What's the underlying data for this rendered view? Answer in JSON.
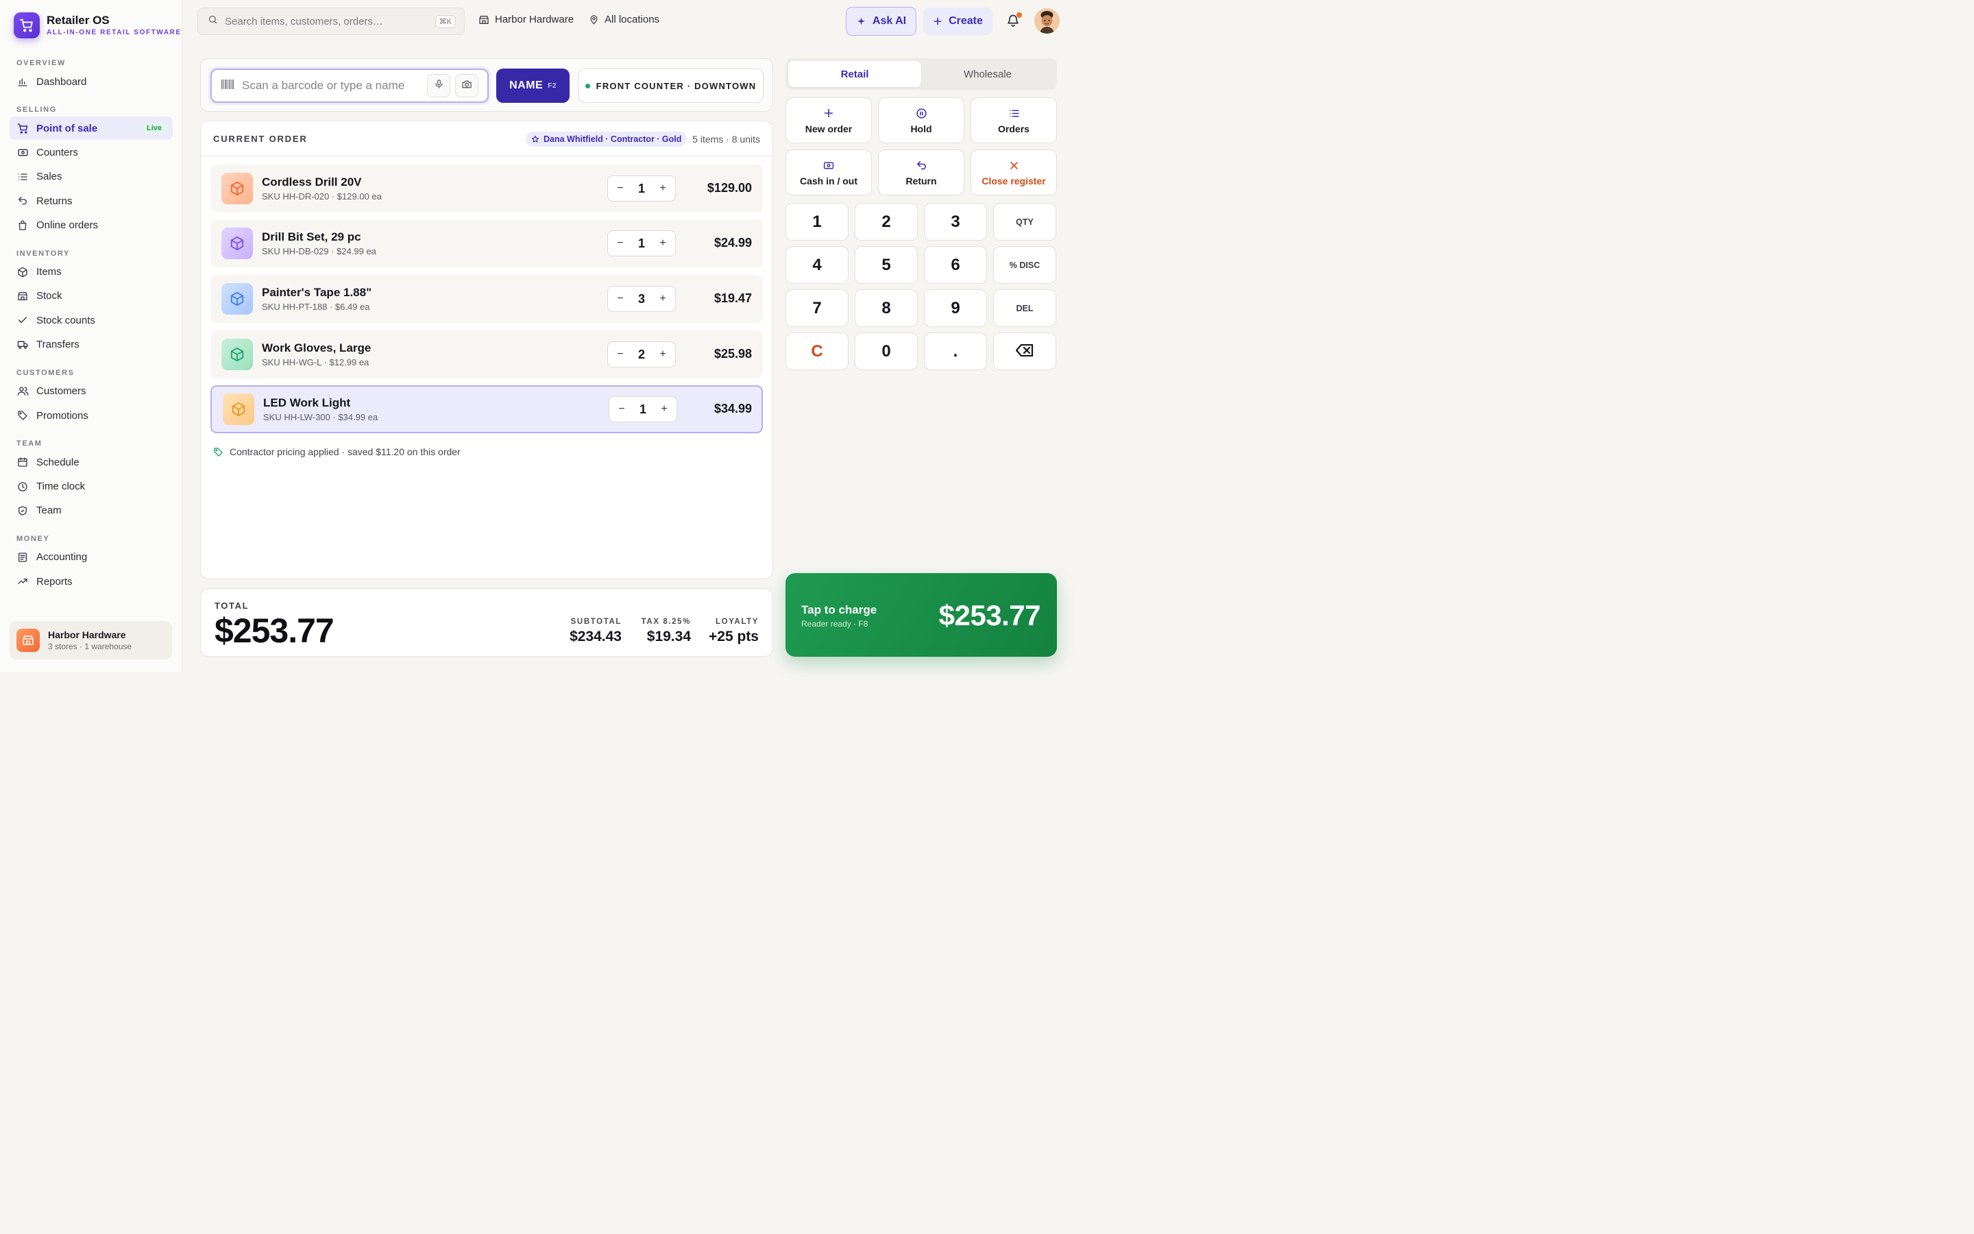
{
  "brand": {
    "name": "Retailer OS",
    "tagline": "ALL-IN-ONE RETAIL SOFTWARE"
  },
  "nav": {
    "sections": {
      "overview": "OVERVIEW",
      "selling": "SELLING",
      "inventory": "INVENTORY",
      "customers": "CUSTOMERS",
      "team": "TEAM",
      "money": "MONEY"
    },
    "items": {
      "dashboard": "Dashboard",
      "pos": "Point of sale",
      "pos_badge": "Live",
      "counters": "Counters",
      "sales": "Sales",
      "returns": "Returns",
      "online_orders": "Online orders",
      "items": "Items",
      "stock": "Stock",
      "stock_counts": "Stock counts",
      "transfers": "Transfers",
      "customers": "Customers",
      "promotions": "Promotions",
      "schedule": "Schedule",
      "time_clock": "Time clock",
      "team": "Team",
      "accounting": "Accounting",
      "reports": "Reports"
    }
  },
  "store": {
    "name": "Harbor Hardware",
    "sub": "3 stores · 1 warehouse"
  },
  "topbar": {
    "search_placeholder": "Search items, customers, orders…",
    "search_shortcut": "⌘K",
    "store": "Harbor Hardware",
    "location": "All locations",
    "ask_ai": "Ask AI",
    "create": "Create"
  },
  "scan": {
    "placeholder": "Scan a barcode or type a name",
    "name_button": "NAME",
    "name_shortcut": "F2",
    "register": "FRONT COUNTER · DOWNTOWN"
  },
  "order": {
    "title": "CURRENT ORDER",
    "customer": "Dana Whitfield · Contractor · Gold",
    "count": "5 items · 8 units",
    "items": [
      {
        "name": "Cordless Drill 20V",
        "sku": "SKU HH-DR-020 · $129.00 ea",
        "qty": "1",
        "price": "$129.00"
      },
      {
        "name": "Drill Bit Set, 29 pc",
        "sku": "SKU HH-DB-029 · $24.99 ea",
        "qty": "1",
        "price": "$24.99"
      },
      {
        "name": "Painter's Tape 1.88\"",
        "sku": "SKU HH-PT-188 · $6.49 ea",
        "qty": "3",
        "price": "$19.47"
      },
      {
        "name": "Work Gloves, Large",
        "sku": "SKU HH-WG-L · $12.99 ea",
        "qty": "2",
        "price": "$25.98"
      },
      {
        "name": "LED Work Light",
        "sku": "SKU HH-LW-300 · $34.99 ea",
        "qty": "1",
        "price": "$34.99"
      }
    ],
    "pricing_note": "Contractor pricing applied · saved $11.20 on this order"
  },
  "totals": {
    "label": "TOTAL",
    "total": "$253.77",
    "subtotal_label": "SUBTOTAL",
    "subtotal": "$234.43",
    "tax_label": "TAX 8.25%",
    "tax": "$19.34",
    "loyalty_label": "LOYALTY",
    "loyalty": "+25 pts"
  },
  "mode_tabs": {
    "retail": "Retail",
    "wholesale": "Wholesale"
  },
  "actions": {
    "new_order": "New order",
    "hold": "Hold",
    "orders": "Orders",
    "cash": "Cash in / out",
    "return": "Return",
    "close_register": "Close register"
  },
  "keypad": {
    "k1": "1",
    "k2": "2",
    "k3": "3",
    "qty": "QTY",
    "k4": "4",
    "k5": "5",
    "k6": "6",
    "disc": "% DISC",
    "k7": "7",
    "k8": "8",
    "k9": "9",
    "del": "DEL",
    "clear": "C",
    "k0": "0",
    "dot": "."
  },
  "charge": {
    "title": "Tap to charge",
    "sub": "Reader ready · F8",
    "amount": "$253.77"
  },
  "colors": {
    "accent": "#3728a8",
    "charge": "#1f9a52",
    "danger": "#d24a16"
  }
}
